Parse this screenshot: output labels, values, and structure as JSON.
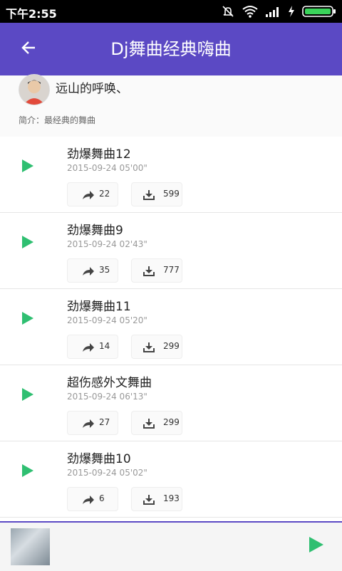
{
  "status": {
    "time": "下午2:55"
  },
  "header": {
    "title": "Dj舞曲经典嗨曲"
  },
  "author": {
    "name": "远山的呼唤、",
    "intro": "简介：最经典的舞曲"
  },
  "tracks": [
    {
      "title": "劲爆舞曲12",
      "date": "2015-09-24 05'00\"",
      "shares": "22",
      "downloads": "599"
    },
    {
      "title": "劲爆舞曲9",
      "date": "2015-09-24 02'43\"",
      "shares": "35",
      "downloads": "777"
    },
    {
      "title": "劲爆舞曲11",
      "date": "2015-09-24 05'20\"",
      "shares": "14",
      "downloads": "299"
    },
    {
      "title": "超伤感外文舞曲",
      "date": "2015-09-24 06'13\"",
      "shares": "27",
      "downloads": "299"
    },
    {
      "title": "劲爆舞曲10",
      "date": "2015-09-24 05'02\"",
      "shares": "6",
      "downloads": "193"
    }
  ],
  "colors": {
    "accent": "#5b49c4",
    "play": "#2fbf71"
  }
}
